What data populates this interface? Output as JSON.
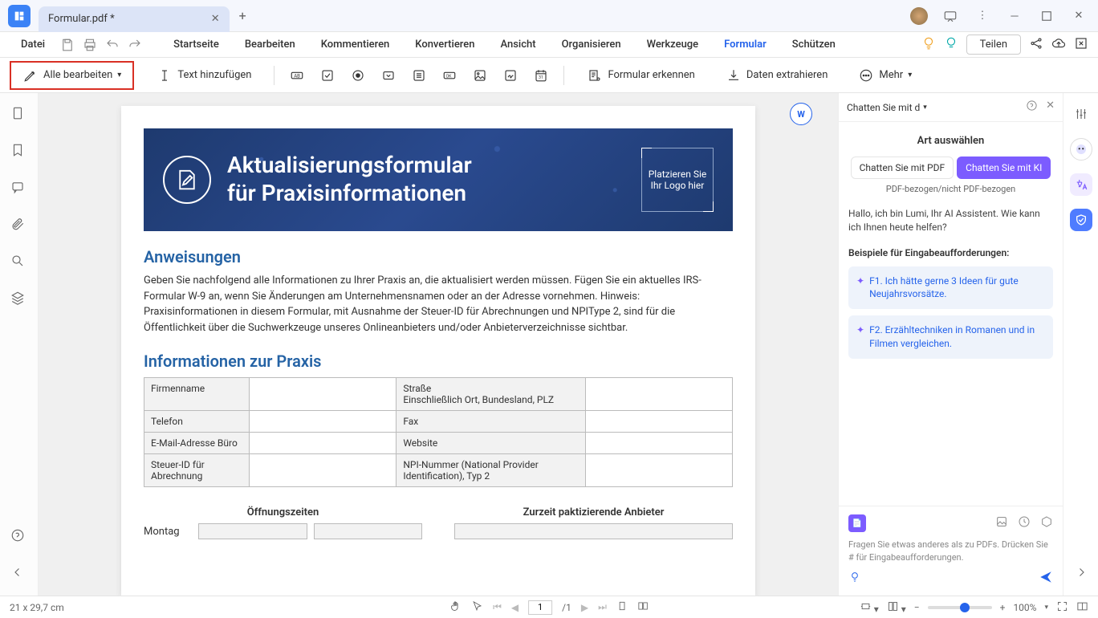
{
  "titlebar": {
    "filename": "Formular.pdf *"
  },
  "menubar": {
    "file": "Datei",
    "items": [
      "Startseite",
      "Bearbeiten",
      "Kommentieren",
      "Konvertieren",
      "Ansicht",
      "Organisieren",
      "Werkzeuge",
      "Formular",
      "Schützen"
    ],
    "active_index": 7,
    "share": "Teilen"
  },
  "toolbar": {
    "edit_all": "Alle bearbeiten",
    "add_text": "Text hinzufügen",
    "recognize_form": "Formular erkennen",
    "extract_data": "Daten extrahieren",
    "more": "Mehr"
  },
  "document": {
    "header_title_l1": "Aktualisierungsformular",
    "header_title_l2": "für Praxisinformationen",
    "logo_placeholder": "Platzieren Sie Ihr Logo hier",
    "instructions_h": "Anweisungen",
    "instructions_p": "Geben Sie nachfolgend alle Informationen zu Ihrer Praxis an, die aktualisiert werden müssen. Fügen Sie ein aktuelles IRS-Formular W-9 an, wenn Sie Änderungen am Unternehmensnamen oder an der Adresse vornehmen. Hinweis: Praxisinformationen in diesem Formular, mit Ausnahme der Steuer-ID für Abrechnungen und NPIType 2, sind für die Öffentlichkeit über die Suchwerkzeuge unseres Onlineanbieters und/oder Anbieterverzeichnisse sichtbar.",
    "info_h": "Informationen zur Praxis",
    "fields": {
      "firmenname": "Firmenname",
      "strasse": "Straße\nEinschließlich Ort, Bundesland, PLZ",
      "telefon": "Telefon",
      "fax": "Fax",
      "email": "E-Mail-Adresse Büro",
      "website": "Website",
      "steuerid": "Steuer-ID für Abrechnung",
      "npi": "NPI-Nummer (National Provider Identification), Typ 2"
    },
    "hours_h": "Öffnungszeiten",
    "providers_h": "Zurzeit paktizierende Anbieter",
    "montag": "Montag"
  },
  "ai": {
    "dropdown": "Chatten Sie mit d",
    "title": "Art auswählen",
    "tab_pdf": "Chatten Sie mit PDF",
    "tab_ki": "Chatten Sie mit KI",
    "subtitle": "PDF-bezogen/nicht PDF-bezogen",
    "greeting": "Hallo, ich bin Lumi, Ihr AI Assistent. Wie kann ich Ihnen heute helfen?",
    "prompts_h": "Beispiele für Eingabeaufforderungen:",
    "prompt1": "F1. Ich hätte gerne 3 Ideen für gute Neujahrsvorsätze.",
    "prompt2": "F2. Erzähltechniken in Romanen und in Filmen vergleichen.",
    "input_hint": "Fragen Sie etwas anderes als zu PDFs. Drücken Sie # für Eingabeaufforderungen."
  },
  "statusbar": {
    "dimensions": "21 x 29,7 cm",
    "page_current": "1",
    "page_total": "/1",
    "zoom": "100%"
  }
}
